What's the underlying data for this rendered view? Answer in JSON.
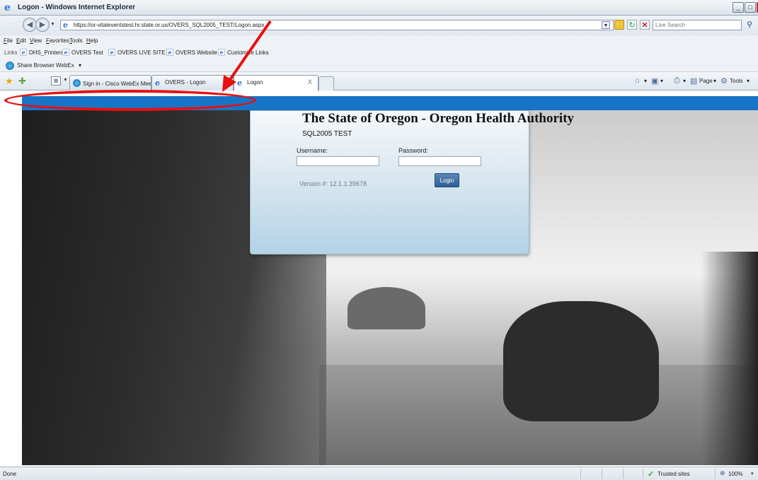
{
  "window": {
    "title": "Logon - Windows Internet Explorer",
    "min": "_",
    "max": "□",
    "close": "×"
  },
  "address": {
    "url": "https://or-vitaleventstest.hr.state.or.us/OVERS_SQL2005_TEST/Logon.aspx",
    "search_placeholder": "Live Search"
  },
  "menu": [
    "File",
    "Edit",
    "View",
    "Favorites",
    "Tools",
    "Help"
  ],
  "links_bar": {
    "label": "Links",
    "items": [
      "DHS_Printers",
      "OVERS Test",
      "OVERS LIVE SITE",
      "OVERS Website",
      "Customize Links"
    ]
  },
  "webex_bar": {
    "items": [
      "Share Browser",
      "WebEx"
    ]
  },
  "tabs": [
    {
      "label": "Sign in - Cisco WebEx Meetings",
      "icon": "webex-globe-icon"
    },
    {
      "label": "OVERS - Logon",
      "icon": "ie-page-icon"
    },
    {
      "label": "Logon",
      "icon": "ie-page-icon",
      "active": true
    }
  ],
  "command_bar": {
    "page": "Page",
    "tools": "Tools"
  },
  "login": {
    "org_title": "The State of Oregon - Oregon Health Authority",
    "environment": "SQL2005 TEST",
    "username_label": "Username:",
    "password_label": "Password:",
    "version": "Version #: 12.1.1.39678",
    "login_button": "Login"
  },
  "status": {
    "text": "Done",
    "zone": "Trusted sites",
    "zoom": "100%"
  },
  "colors": {
    "header_strip": "#1874c6",
    "annotation": "#e81010",
    "login_button": "#2f5e94"
  }
}
